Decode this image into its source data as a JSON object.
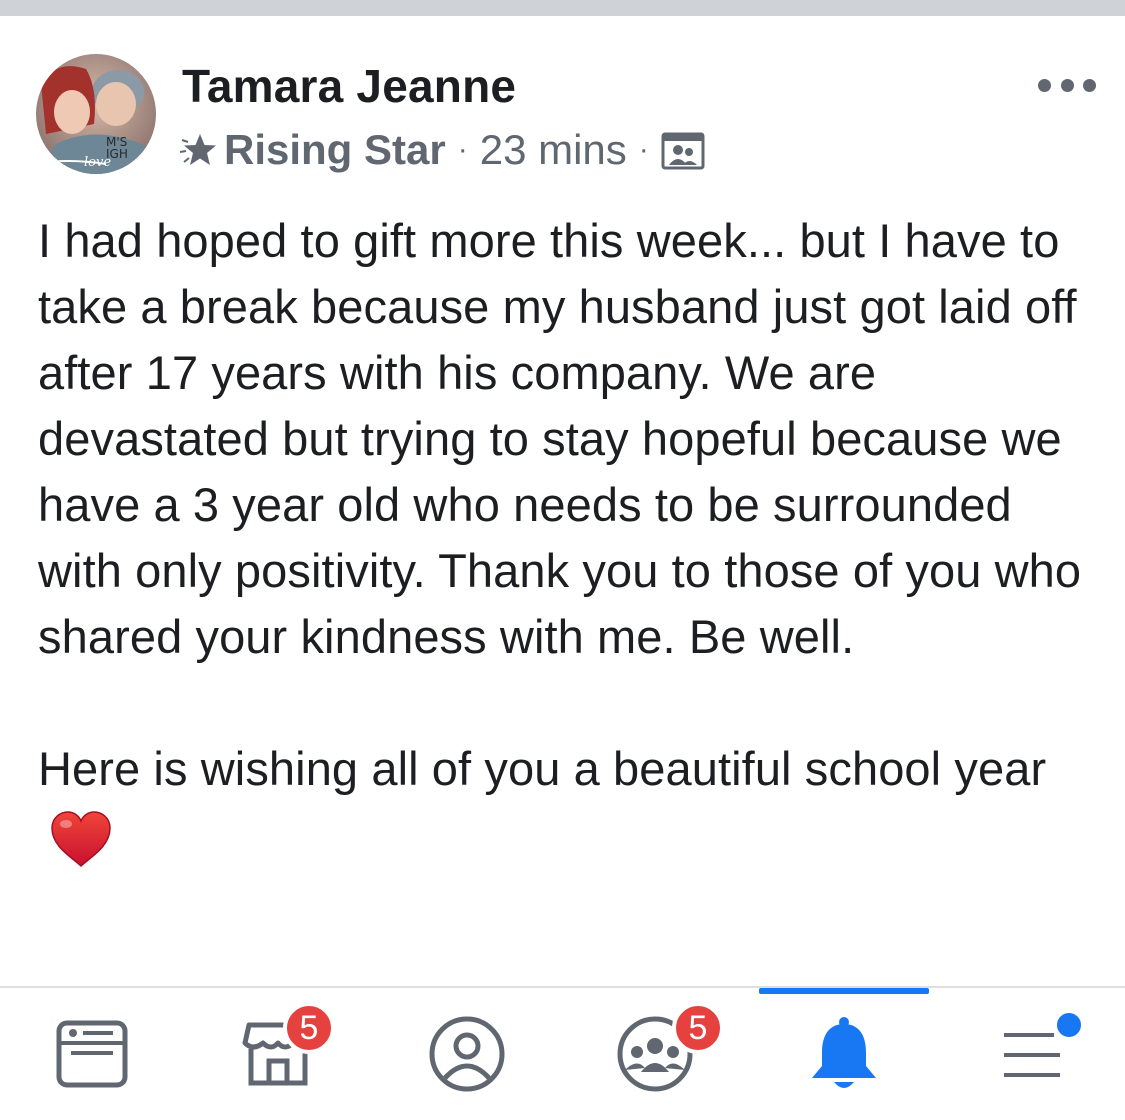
{
  "post": {
    "author_name": "Tamara Jeanne",
    "avatar_text": "love",
    "badge_label": "Rising Star",
    "time": "23 mins",
    "separator": "·",
    "paragraphs": [
      "I had hoped to gift more this week... but I have to take a break because my husband just got laid off after 17 years with his company. We are devastated but trying to stay hopeful because we have a 3 year old who needs to be surrounded with only positivity. Thank you to those of you who shared your kindness with me. Be well.",
      "Here is wishing all of you a beautiful school year"
    ]
  },
  "tabbar": {
    "tabs": [
      {
        "id": "news-feed",
        "icon": "news-feed-icon",
        "badge": null,
        "active": false
      },
      {
        "id": "marketplace",
        "icon": "marketplace-icon",
        "badge": "5",
        "active": false
      },
      {
        "id": "profile",
        "icon": "profile-icon",
        "badge": null,
        "active": false
      },
      {
        "id": "groups",
        "icon": "groups-icon",
        "badge": "5",
        "active": false
      },
      {
        "id": "notifications",
        "icon": "bell-icon",
        "badge": null,
        "active": true
      },
      {
        "id": "menu",
        "icon": "menu-icon",
        "badge": null,
        "active": false
      }
    ]
  },
  "colors": {
    "accent": "#1877f2",
    "badge_red": "#e4413f",
    "icon_gray": "#606770",
    "text": "#1c1e21"
  }
}
